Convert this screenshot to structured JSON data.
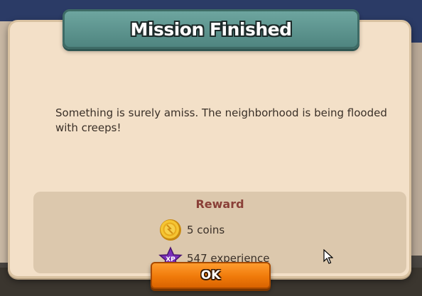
{
  "dialog": {
    "title": "Mission Finished",
    "message": "Something is surely amiss. The neighborhood is being flooded with creeps!",
    "reward": {
      "title": "Reward",
      "items": [
        {
          "icon": "coin-icon",
          "text": "5 coins"
        },
        {
          "icon": "xp-star-icon",
          "text": "547 experience",
          "badge": "XP"
        }
      ]
    },
    "ok_label": "OK"
  },
  "colors": {
    "panel": "#f3e0c8",
    "banner": "#5a918b",
    "reward_panel": "#dcc8ad",
    "reward_title": "#8a4038",
    "ok_button": "#f07a0a"
  }
}
